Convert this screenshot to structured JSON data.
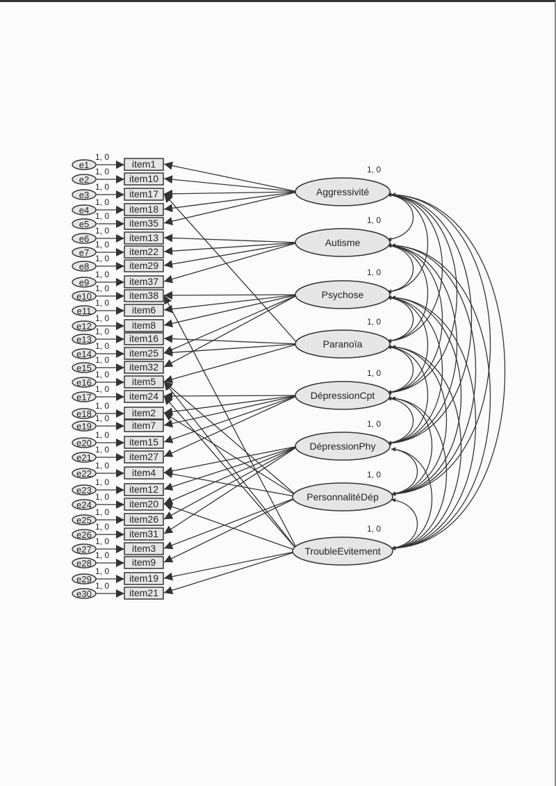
{
  "fixed_parameter_label": "1, 0",
  "errors": [
    "e1",
    "e2",
    "e3",
    "e4",
    "e5",
    "e6",
    "e7",
    "e8",
    "e9",
    "e10",
    "e11",
    "e12",
    "e13",
    "e14",
    "e15",
    "e16",
    "e17",
    "e18",
    "e19",
    "e20",
    "e21",
    "e22",
    "e23",
    "e24",
    "e25",
    "e26",
    "e27",
    "e28",
    "e29",
    "e30"
  ],
  "items": [
    "item1",
    "item10",
    "item17",
    "item18",
    "item35",
    "item13",
    "item22",
    "item29",
    "item37",
    "item38",
    "item6",
    "item8",
    "item16",
    "item25",
    "item32",
    "item5",
    "item24",
    "item2",
    "item7",
    "item15",
    "item27",
    "item4",
    "item12",
    "item20",
    "item26",
    "item31",
    "item3",
    "item9",
    "item19",
    "item21"
  ],
  "factors": [
    {
      "name": "Aggressivité",
      "items": [
        "item1",
        "item10",
        "item17",
        "item18",
        "item35"
      ]
    },
    {
      "name": "Autisme",
      "items": [
        "item13",
        "item22",
        "item29",
        "item37"
      ]
    },
    {
      "name": "Psychose",
      "items": [
        "item38",
        "item6",
        "item8",
        "item25",
        "item32"
      ]
    },
    {
      "name": "Paranoïa",
      "items": [
        "item16",
        "item25",
        "item17",
        "item5"
      ]
    },
    {
      "name": "DépressionCpt",
      "items": [
        "item24",
        "item2",
        "item7",
        "item15",
        "item27"
      ]
    },
    {
      "name": "DépressionPhy",
      "items": [
        "item4",
        "item12",
        "item20",
        "item26",
        "item31"
      ]
    },
    {
      "name": "PersonnalitéDép",
      "items": [
        "item3",
        "item9",
        "item2",
        "item4",
        "item5"
      ]
    },
    {
      "name": "TroubleEvitement",
      "items": [
        "item19",
        "item21",
        "item38",
        "item5",
        "item20",
        "item24"
      ]
    }
  ],
  "colors": {
    "node_fill": "#e6e6e6",
    "stroke": "#333333"
  }
}
